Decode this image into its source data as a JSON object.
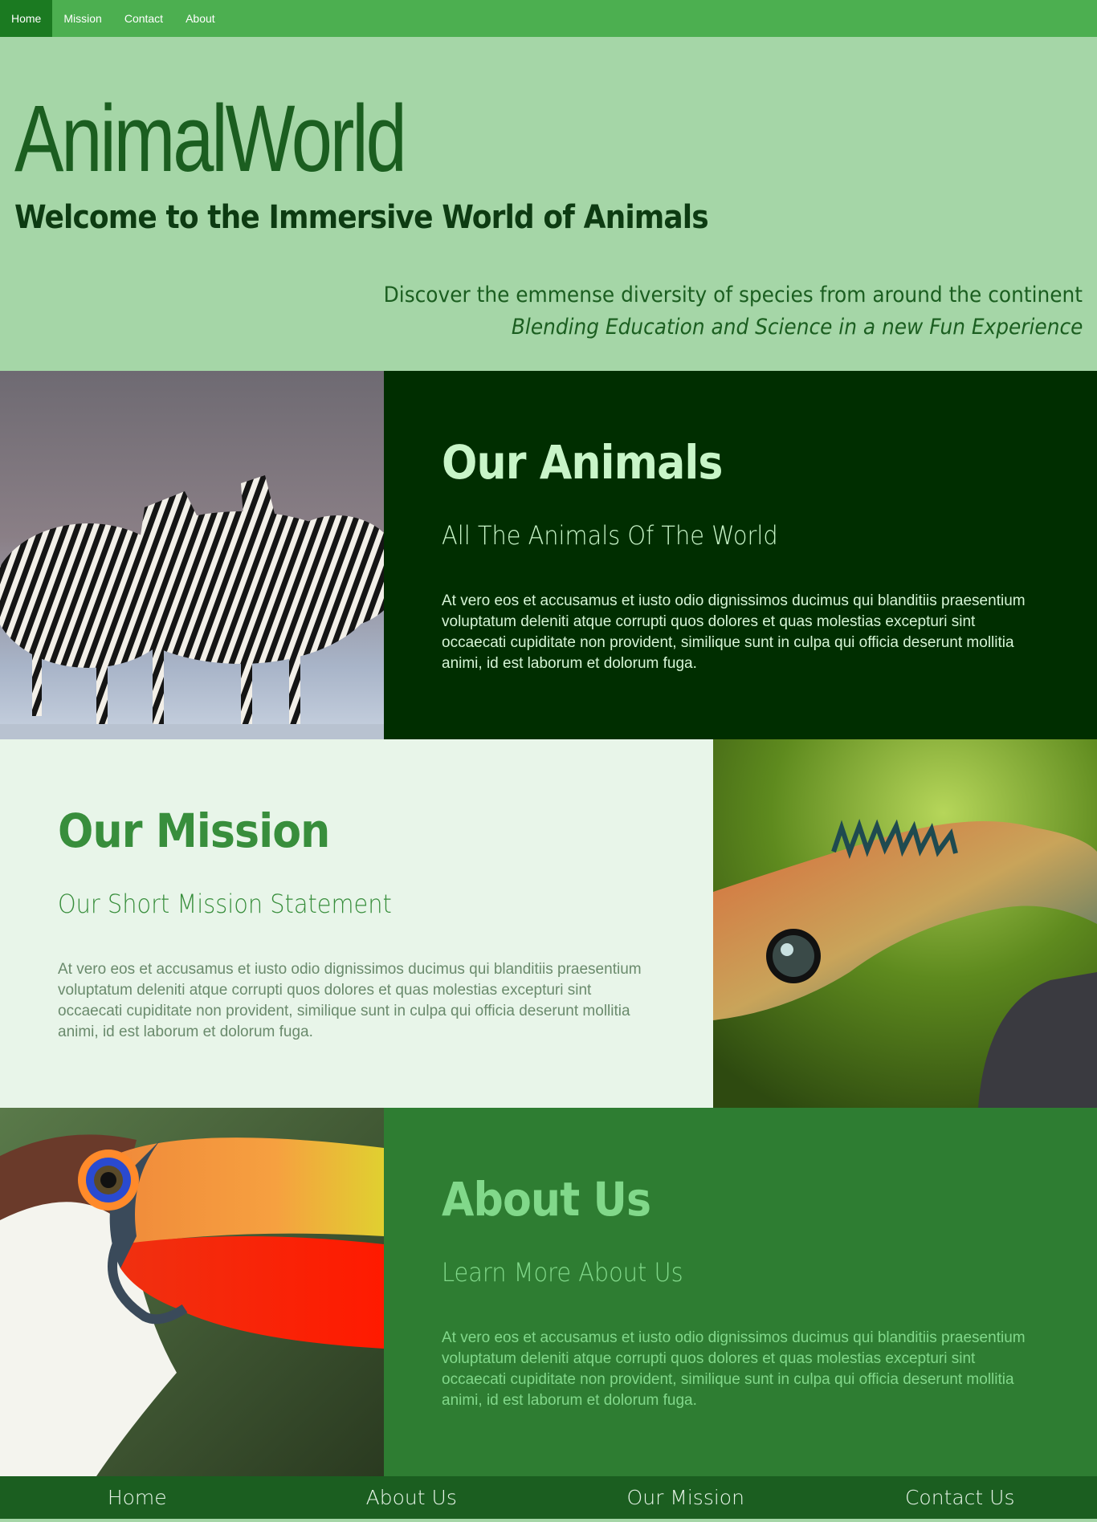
{
  "topnav": {
    "items": [
      "Home",
      "Mission",
      "Contact",
      "About"
    ],
    "active": "Home"
  },
  "header": {
    "logo": "AnimalWorld",
    "welcome": "Welcome to the Immersive World of Animals",
    "tagline1": "Discover the emmense diversity of species from around the continent",
    "tagline2": "Blending Education and Science in a new Fun Experience"
  },
  "animals": {
    "title": "Our Animals",
    "subtitle": "All The Animals Of The World",
    "body": "At vero eos et accusamus et iusto odio dignissimos ducimus qui blanditiis praesentium voluptatum deleniti atque corrupti quos dolores et quas molestias excepturi sint occaecati cupiditate non provident, similique sunt in culpa qui officia deserunt mollitia animi, id est laborum et dolorum fuga."
  },
  "mission": {
    "title": "Our Mission",
    "subtitle": "Our Short Mission Statement",
    "body": "At vero eos et accusamus et iusto odio dignissimos ducimus qui blanditiis praesentium voluptatum deleniti atque corrupti quos dolores et quas molestias excepturi sint occaecati cupiditate non provident, similique sunt in culpa qui officia deserunt mollitia animi, id est laborum et dolorum fuga."
  },
  "about": {
    "title": "About Us",
    "subtitle": "Learn More About Us",
    "body": "At vero eos et accusamus et iusto odio dignissimos ducimus qui blanditiis praesentium voluptatum deleniti atque corrupti quos dolores et quas molestias excepturi sint occaecati cupiditate non provident, similique sunt in culpa qui officia deserunt mollitia animi, id est laborum et dolorum fuga."
  },
  "footer": {
    "items": [
      "Home",
      "About Us",
      "Our Mission",
      "Contact Us"
    ]
  },
  "colors": {
    "nav": "#4caf50",
    "nav_active": "#1b7a21",
    "header_bg": "#a5d6a7",
    "animals_bg": "#002e00",
    "mission_bg": "#e8f5e9",
    "about_bg": "#2e7d32",
    "footer_bg": "#1b5e20"
  }
}
